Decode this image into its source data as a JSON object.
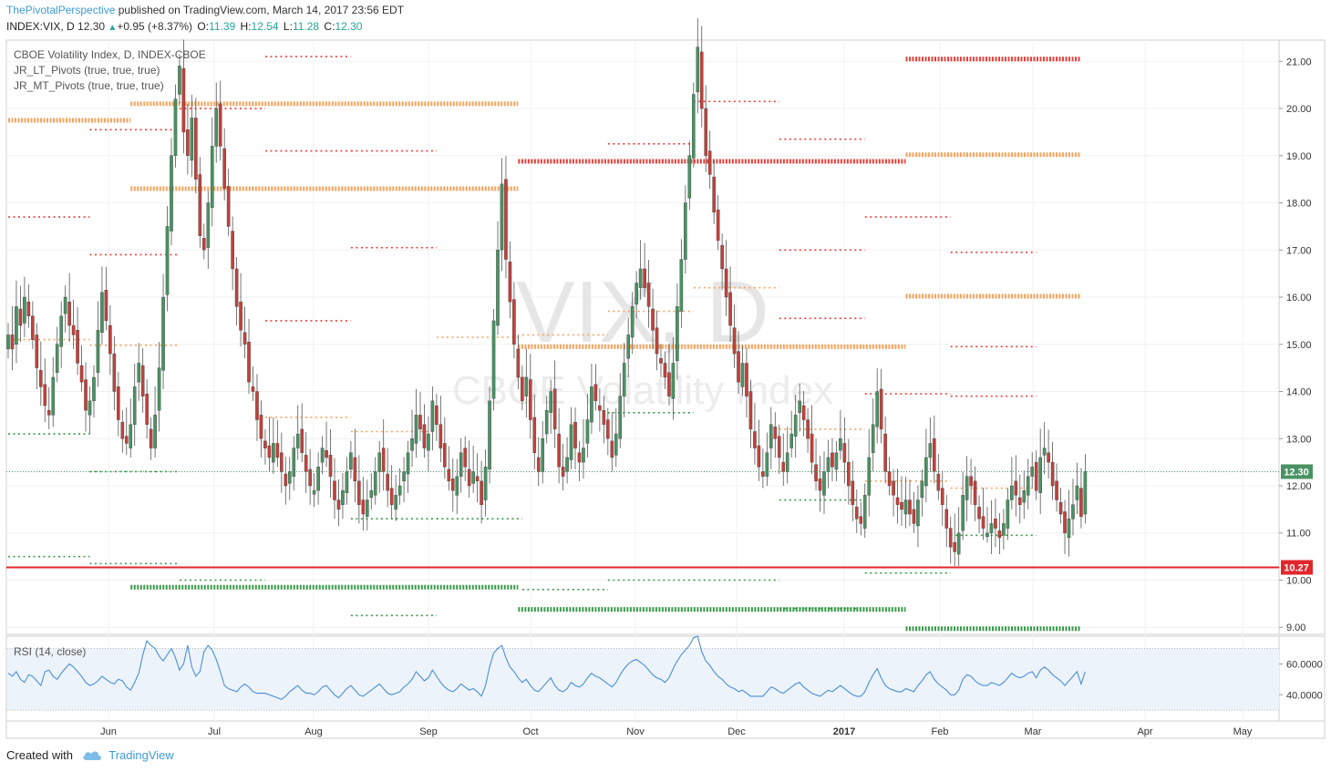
{
  "header": {
    "author": "ThePivotalPerspective",
    "published": "published on TradingView.com, March 14, 2017 23:56 EDT",
    "symbol": "INDEX:VIX, D",
    "last": "12.30",
    "change_arrow": "▲",
    "change": "+0.95 (+8.37%)",
    "open_label": "O:",
    "open": "11.39",
    "high_label": "H:",
    "high": "12.54",
    "low_label": "L:",
    "low": "11.28",
    "close_label": "C:",
    "close": "12.30"
  },
  "legend": {
    "title": "CBOE Volatility Index, D, INDEX-CBOE",
    "indicator1": "JR_LT_Pivots (true, true, true)",
    "indicator2": "JR_MT_Pivots (true, true, true)"
  },
  "watermark": {
    "big": "VIX, D",
    "sub": "CBOE Volatility Index"
  },
  "footer": {
    "created_with": "Created with",
    "brand": "TradingView"
  },
  "colors": {
    "up": "#4a9263",
    "down": "#c4403a",
    "orange": "#f7a35c",
    "red_pivot": "#e8403a",
    "green_pivot": "#3a9a4a",
    "rsi": "#4a8fd6",
    "price_badge": "#4a9263",
    "support_badge": "#e3262b"
  },
  "chart_data": [
    {
      "type": "candlestick",
      "title": "CBOE Volatility Index, D, INDEX-CBOE",
      "x_labels": [
        "Jun",
        "Jul",
        "Aug",
        "Sep",
        "Oct",
        "Nov",
        "Dec",
        "2017",
        "Feb",
        "Mar",
        "Apr",
        "May"
      ],
      "y_ticks": [
        "21.00",
        "20.00",
        "19.00",
        "18.00",
        "17.00",
        "16.00",
        "15.00",
        "14.00",
        "13.00",
        "12.00",
        "11.00",
        "10.00",
        "9.00"
      ],
      "ylim": [
        8.85,
        21.45
      ],
      "last_price": "12.30",
      "support_label": "10.27",
      "support_level": 10.27,
      "closes": [
        15.2,
        14.9,
        15.8,
        15.4,
        16.0,
        15.6,
        15.1,
        14.5,
        14.1,
        13.7,
        13.5,
        14.3,
        15.0,
        15.6,
        16.0,
        15.4,
        15.2,
        14.6,
        14.2,
        13.6,
        13.8,
        14.3,
        15.3,
        16.1,
        15.5,
        14.8,
        14.0,
        13.4,
        13.0,
        12.9,
        13.3,
        14.1,
        14.6,
        13.9,
        13.3,
        12.8,
        13.5,
        14.5,
        16.0,
        17.5,
        19.0,
        20.2,
        20.9,
        19.5,
        19.0,
        19.8,
        18.5,
        17.3,
        17.0,
        18.0,
        19.2,
        20.0,
        19.2,
        18.3,
        17.5,
        16.6,
        15.8,
        15.3,
        15.0,
        14.2,
        14.0,
        13.4,
        13.0,
        12.8,
        12.6,
        12.9,
        12.6,
        12.3,
        12.0,
        12.3,
        12.8,
        13.1,
        12.7,
        12.3,
        12.0,
        11.9,
        12.4,
        12.8,
        12.6,
        12.2,
        11.7,
        11.5,
        11.9,
        12.3,
        12.7,
        12.1,
        11.6,
        11.4,
        11.7,
        11.9,
        12.3,
        12.7,
        12.3,
        11.9,
        11.6,
        11.8,
        12.0,
        12.3,
        12.7,
        13.0,
        13.5,
        13.2,
        12.8,
        13.1,
        13.8,
        13.3,
        12.8,
        12.4,
        12.1,
        11.9,
        12.2,
        12.7,
        12.4,
        12.0,
        12.3,
        12.1,
        11.6,
        12.4,
        13.8,
        15.5,
        17.0,
        18.4,
        16.8,
        15.9,
        15.0,
        14.3,
        13.8,
        14.3,
        13.4,
        12.7,
        12.3,
        13.0,
        13.6,
        14.0,
        13.2,
        12.4,
        12.2,
        12.6,
        13.3,
        12.8,
        12.5,
        12.8,
        13.4,
        14.1,
        13.8,
        13.6,
        13.3,
        13.0,
        12.6,
        13.1,
        13.9,
        14.6,
        15.2,
        15.8,
        16.3,
        16.6,
        16.2,
        15.8,
        15.3,
        14.8,
        14.6,
        14.3,
        13.9,
        14.6,
        15.8,
        16.8,
        18.0,
        19.0,
        20.3,
        21.3,
        20.0,
        19.0,
        18.6,
        17.8,
        17.2,
        16.6,
        16.0,
        15.4,
        14.8,
        14.2,
        14.6,
        13.9,
        13.2,
        12.8,
        12.4,
        12.2,
        12.7,
        13.3,
        13.0,
        12.6,
        12.3,
        12.7,
        13.1,
        13.5,
        13.8,
        13.4,
        13.0,
        12.5,
        12.1,
        11.9,
        12.3,
        12.6,
        12.4,
        12.7,
        13.0,
        12.5,
        12.0,
        11.6,
        11.3,
        11.2,
        11.8,
        12.6,
        13.3,
        14.0,
        13.2,
        12.3,
        12.0,
        11.8,
        11.6,
        11.5,
        11.7,
        11.4,
        11.2,
        11.7,
        12.1,
        12.6,
        12.9,
        12.3,
        11.9,
        11.6,
        11.1,
        10.7,
        10.6,
        11.0,
        11.8,
        12.2,
        12.0,
        11.6,
        11.3,
        11.1,
        11.0,
        11.2,
        11.1,
        10.9,
        11.2,
        11.7,
        12.0,
        11.8,
        11.6,
        11.9,
        12.2,
        12.4,
        11.9,
        12.6,
        12.8,
        12.5,
        12.0,
        11.7,
        11.4,
        11.0,
        11.3,
        11.6,
        12.0,
        11.35,
        12.3
      ],
      "overlay_series": [
        {
          "name": "JR_LT_Pivots",
          "style": "thick",
          "levels": [
            {
              "from": 0,
              "to": 30,
              "level": 19.75,
              "color": "#f7a35c"
            },
            {
              "from": 30,
              "to": 125,
              "level": 18.3,
              "color": "#f7a35c"
            },
            {
              "from": 30,
              "to": 125,
              "level": 20.1,
              "color": "#f7a35c"
            },
            {
              "from": 30,
              "to": 125,
              "level": 9.85,
              "color": "#3a9a4a"
            },
            {
              "from": 125,
              "to": 220,
              "level": 18.88,
              "color": "#e8403a"
            },
            {
              "from": 125,
              "to": 220,
              "level": 14.95,
              "color": "#f7a35c"
            },
            {
              "from": 125,
              "to": 220,
              "level": 9.38,
              "color": "#3a9a4a"
            },
            {
              "from": 220,
              "to": 268,
              "level": 21.05,
              "color": "#e8403a"
            },
            {
              "from": 220,
              "to": 268,
              "level": 19.02,
              "color": "#f7a35c"
            },
            {
              "from": 220,
              "to": 268,
              "level": 16.02,
              "color": "#f7a35c"
            },
            {
              "from": 220,
              "to": 268,
              "level": 8.97,
              "color": "#3a9a4a"
            }
          ]
        },
        {
          "name": "JR_MT_Pivots",
          "style": "thin",
          "levels": [
            {
              "from": 0,
              "to": 20,
              "level": 17.7,
              "color": "#e8403a"
            },
            {
              "from": 0,
              "to": 20,
              "level": 15.1,
              "color": "#f7a35c"
            },
            {
              "from": 0,
              "to": 20,
              "level": 13.1,
              "color": "#3a9a4a"
            },
            {
              "from": 0,
              "to": 20,
              "level": 10.5,
              "color": "#3a9a4a"
            },
            {
              "from": 20,
              "to": 42,
              "level": 19.55,
              "color": "#e8403a"
            },
            {
              "from": 20,
              "to": 42,
              "level": 16.9,
              "color": "#e8403a"
            },
            {
              "from": 20,
              "to": 42,
              "level": 14.98,
              "color": "#f7a35c"
            },
            {
              "from": 20,
              "to": 42,
              "level": 12.3,
              "color": "#3a9a4a"
            },
            {
              "from": 20,
              "to": 42,
              "level": 10.35,
              "color": "#3a9a4a"
            },
            {
              "from": 42,
              "to": 63,
              "level": 20.0,
              "color": "#e8403a"
            },
            {
              "from": 42,
              "to": 63,
              "level": 10.0,
              "color": "#3a9a4a"
            },
            {
              "from": 63,
              "to": 84,
              "level": 21.1,
              "color": "#e8403a"
            },
            {
              "from": 63,
              "to": 84,
              "level": 19.1,
              "color": "#e8403a"
            },
            {
              "from": 63,
              "to": 84,
              "level": 15.5,
              "color": "#e8403a"
            },
            {
              "from": 63,
              "to": 84,
              "level": 13.45,
              "color": "#f7a35c"
            },
            {
              "from": 84,
              "to": 105,
              "level": 19.1,
              "color": "#e8403a"
            },
            {
              "from": 84,
              "to": 105,
              "level": 17.05,
              "color": "#e8403a"
            },
            {
              "from": 84,
              "to": 105,
              "level": 13.15,
              "color": "#f7a35c"
            },
            {
              "from": 84,
              "to": 105,
              "level": 11.3,
              "color": "#3a9a4a"
            },
            {
              "from": 84,
              "to": 105,
              "level": 9.25,
              "color": "#3a9a4a"
            },
            {
              "from": 105,
              "to": 126,
              "level": 15.15,
              "color": "#f7a35c"
            },
            {
              "from": 105,
              "to": 126,
              "level": 11.3,
              "color": "#3a9a4a"
            },
            {
              "from": 126,
              "to": 147,
              "level": 9.8,
              "color": "#3a9a4a"
            },
            {
              "from": 126,
              "to": 147,
              "level": 15.2,
              "color": "#f7a35c"
            },
            {
              "from": 147,
              "to": 168,
              "level": 19.25,
              "color": "#e8403a"
            },
            {
              "from": 147,
              "to": 168,
              "level": 15.7,
              "color": "#f7a35c"
            },
            {
              "from": 147,
              "to": 168,
              "level": 13.55,
              "color": "#3a9a4a"
            },
            {
              "from": 147,
              "to": 168,
              "level": 10.0,
              "color": "#3a9a4a"
            },
            {
              "from": 168,
              "to": 189,
              "level": 20.15,
              "color": "#e8403a"
            },
            {
              "from": 168,
              "to": 189,
              "level": 16.2,
              "color": "#f7a35c"
            },
            {
              "from": 168,
              "to": 189,
              "level": 10.0,
              "color": "#3a9a4a"
            },
            {
              "from": 189,
              "to": 210,
              "level": 19.35,
              "color": "#e8403a"
            },
            {
              "from": 189,
              "to": 210,
              "level": 17.0,
              "color": "#e8403a"
            },
            {
              "from": 189,
              "to": 210,
              "level": 15.55,
              "color": "#e8403a"
            },
            {
              "from": 189,
              "to": 210,
              "level": 13.2,
              "color": "#f7a35c"
            },
            {
              "from": 189,
              "to": 210,
              "level": 11.7,
              "color": "#3a9a4a"
            },
            {
              "from": 189,
              "to": 210,
              "level": 9.4,
              "color": "#3a9a4a"
            },
            {
              "from": 210,
              "to": 231,
              "level": 17.7,
              "color": "#e8403a"
            },
            {
              "from": 210,
              "to": 231,
              "level": 13.95,
              "color": "#e8403a"
            },
            {
              "from": 210,
              "to": 231,
              "level": 12.1,
              "color": "#f7a35c"
            },
            {
              "from": 210,
              "to": 231,
              "level": 10.15,
              "color": "#3a9a4a"
            },
            {
              "from": 231,
              "to": 252,
              "level": 16.95,
              "color": "#e8403a"
            },
            {
              "from": 231,
              "to": 252,
              "level": 14.95,
              "color": "#e8403a"
            },
            {
              "from": 231,
              "to": 252,
              "level": 13.9,
              "color": "#e8403a"
            },
            {
              "from": 231,
              "to": 252,
              "level": 11.95,
              "color": "#f7a35c"
            },
            {
              "from": 231,
              "to": 252,
              "level": 10.95,
              "color": "#3a9a4a"
            }
          ]
        }
      ]
    },
    {
      "type": "line",
      "title": "RSI (14, close)",
      "y_ticks": [
        "60.0000",
        "40.0000"
      ],
      "ylim": [
        23,
        78
      ],
      "reference_levels": [
        70,
        30
      ],
      "values": [
        54,
        52,
        55,
        50,
        48,
        53,
        52,
        49,
        46,
        55,
        56,
        52,
        50,
        54,
        57,
        60,
        58,
        55,
        52,
        48,
        46,
        47,
        49,
        52,
        50,
        48,
        47,
        50,
        49,
        45,
        43,
        48,
        54,
        66,
        75,
        72,
        70,
        65,
        62,
        66,
        70,
        64,
        56,
        60,
        72,
        58,
        52,
        55,
        68,
        72,
        69,
        63,
        55,
        46,
        44,
        43,
        42,
        45,
        47,
        45,
        42,
        41,
        41,
        41,
        40,
        39,
        38,
        37,
        39,
        42,
        44,
        46,
        43,
        41,
        41,
        40,
        42,
        45,
        46,
        43,
        40,
        38,
        41,
        44,
        46,
        43,
        40,
        39,
        41,
        43,
        45,
        47,
        44,
        41,
        40,
        41,
        42,
        45,
        47,
        50,
        55,
        52,
        49,
        51,
        56,
        52,
        48,
        45,
        43,
        42,
        44,
        47,
        45,
        43,
        44,
        42,
        39,
        46,
        58,
        67,
        70,
        72,
        64,
        58,
        55,
        51,
        48,
        50,
        46,
        43,
        42,
        45,
        48,
        51,
        46,
        43,
        42,
        44,
        48,
        46,
        45,
        47,
        51,
        54,
        52,
        51,
        49,
        47,
        45,
        48,
        53,
        57,
        60,
        62,
        63,
        61,
        59,
        56,
        53,
        51,
        50,
        48,
        51,
        57,
        62,
        66,
        69,
        72,
        77,
        78,
        68,
        62,
        59,
        55,
        52,
        50,
        47,
        45,
        44,
        42,
        43,
        41,
        39,
        39,
        39,
        39,
        42,
        45,
        44,
        42,
        41,
        43,
        45,
        47,
        48,
        45,
        43,
        41,
        40,
        39,
        41,
        43,
        42,
        44,
        46,
        44,
        42,
        40,
        39,
        39,
        42,
        48,
        53,
        57,
        51,
        46,
        44,
        43,
        42,
        42,
        44,
        43,
        42,
        46,
        49,
        53,
        55,
        50,
        47,
        45,
        43,
        40,
        40,
        43,
        50,
        53,
        52,
        49,
        47,
        46,
        46,
        48,
        47,
        46,
        48,
        51,
        54,
        52,
        51,
        52,
        54,
        55,
        51,
        56,
        58,
        56,
        53,
        51,
        49,
        46,
        49,
        52,
        55,
        47,
        55
      ]
    }
  ]
}
